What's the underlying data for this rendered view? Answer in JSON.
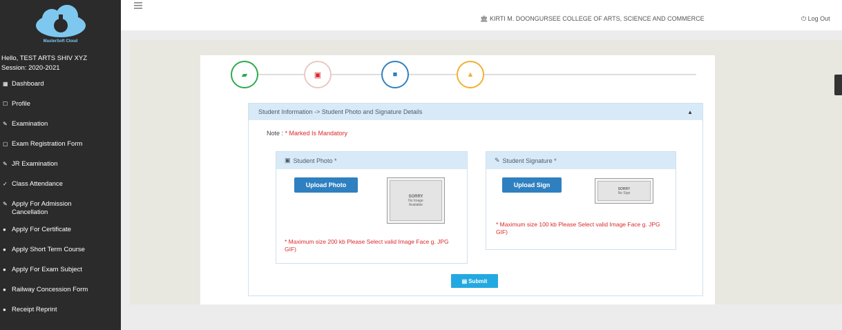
{
  "sidebar": {
    "brand_caption": "MasterSoft Cloud",
    "user_line1": "Hello, TEST ARTS SHIV XYZ",
    "user_line2": "Session: 2020-2021",
    "items": [
      {
        "icon": "dashboard-icon",
        "glyph": "▦",
        "label": "Dashboard"
      },
      {
        "icon": "profile-icon",
        "glyph": "☐",
        "label": "Profile"
      },
      {
        "icon": "examination-icon",
        "glyph": "✎",
        "label": "Examination"
      },
      {
        "icon": "exam-form-icon",
        "glyph": "▢",
        "label": "Exam Registration Form"
      },
      {
        "icon": "jr-examination-icon",
        "glyph": "✎",
        "label": "JR Examination"
      },
      {
        "icon": "attendance-icon",
        "glyph": "✓",
        "label": "Class Attendance"
      },
      {
        "icon": "admission-cancel-icon",
        "glyph": "✎",
        "label": "Apply For Admission Cancellation"
      },
      {
        "icon": "certificate-icon",
        "glyph": "●",
        "label": "Apply For Certificate"
      },
      {
        "icon": "short-course-icon",
        "glyph": "●",
        "label": "Apply Short Term Course"
      },
      {
        "icon": "exam-subject-icon",
        "glyph": "●",
        "label": "Apply For Exam Subject"
      },
      {
        "icon": "railway-icon",
        "glyph": "●",
        "label": "Railway Concession Form"
      },
      {
        "icon": "receipt-icon",
        "glyph": "●",
        "label": "Receipt Reprint"
      }
    ]
  },
  "topbar": {
    "college": "KIRTI M. DOONGURSEE COLLEGE OF ARTS, SCIENCE AND COMMERCE",
    "logout": "Log Out"
  },
  "stepper": {
    "steps": [
      {
        "name": "step-basic-info",
        "color": "#2fa84f",
        "glyph": "▰"
      },
      {
        "name": "step-photo-signature",
        "color": "#e8c9c4",
        "glyph": "▣"
      },
      {
        "name": "step-documents",
        "color": "#2f80c0",
        "glyph": "■"
      },
      {
        "name": "step-confirm",
        "color": "#f0b030",
        "glyph": "▲"
      }
    ]
  },
  "card": {
    "title": "Student Information -> Student Photo and Signature Details",
    "note_label": "Note : ",
    "note_text": "* Marked Is Mandatory"
  },
  "photo_box": {
    "title": "Student Photo *",
    "button": "Upload Photo",
    "thumb_line1": "SORRY",
    "thumb_line2": "No Image",
    "thumb_line3": "Available",
    "warning": "* Maximum size 200 kb Please Select valid Image Face g. JPG GIF)"
  },
  "sign_box": {
    "title": "Student Signature *",
    "button": "Upload Sign",
    "thumb_line1": "SORRY",
    "thumb_line2": "No Sign",
    "warning": "* Maximum size 100 kb Please Select valid Image Face g. JPG GIF)"
  },
  "submit": "Submit"
}
